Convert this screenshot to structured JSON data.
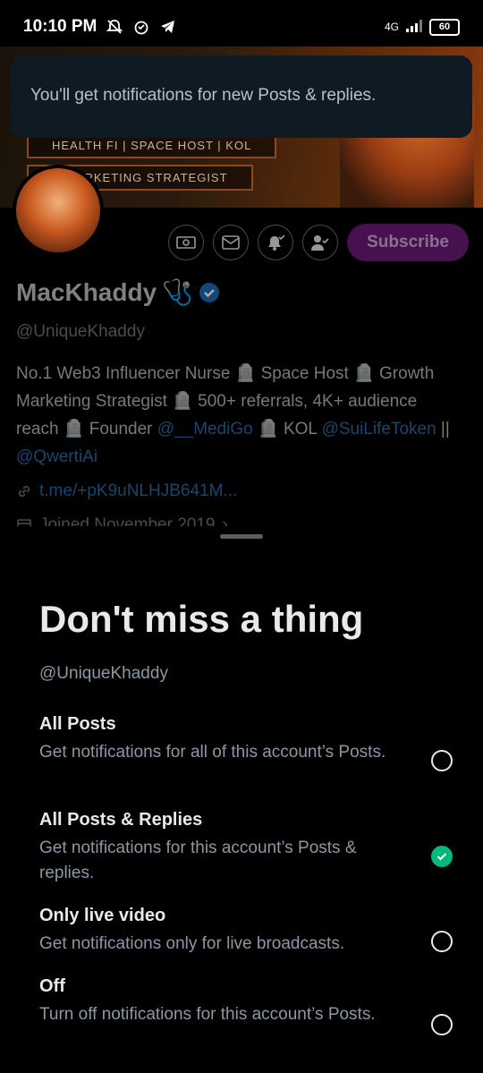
{
  "status_bar": {
    "time": "10:10 PM",
    "network": "4G",
    "battery": "60"
  },
  "banner": {
    "tag1": "HEALTH FI | SPACE HOST | KOL",
    "tag2": "H MARKETING STRATEGIST"
  },
  "toast": {
    "text": "You'll get notifications for new Posts & replies."
  },
  "profile": {
    "name": "MacKhaddy",
    "name_emoji": "🩺",
    "handle": "@UniqueKhaddy",
    "bio": {
      "p1": "No.1 Web3 Influencer Nurse 🪦 Space Host 🪦 Growth Marketing Strategist 🪦 500+ referrals, 4K+ audience reach 🪦 Founder ",
      "m1": "@__MediGo",
      "p2": " 🪦 KOL ",
      "m2": "@SuiLifeToken",
      "p3": " || ",
      "m3": "@QwertiAi"
    },
    "link": "t.me/+pK9uNLHJB641M...",
    "joined": "Joined November 2019",
    "subscribe_label": "Subscribe"
  },
  "sheet": {
    "title": "Don't miss a thing",
    "handle": "@UniqueKhaddy",
    "options": [
      {
        "title": "All Posts",
        "desc": "Get notifications for all of this account’s Posts.",
        "selected": false
      },
      {
        "title": "All Posts & Replies",
        "desc": "Get notifications for this account’s Posts & replies.",
        "selected": true
      },
      {
        "title": "Only live video",
        "desc": "Get notifications only for live broadcasts.",
        "selected": false
      },
      {
        "title": "Off",
        "desc": "Turn off notifications for this account’s Posts.",
        "selected": false
      }
    ]
  },
  "colors": {
    "accent_subscribe": "#6d1b7b",
    "selected": "#00ba7c",
    "link": "#2a6aa8"
  }
}
